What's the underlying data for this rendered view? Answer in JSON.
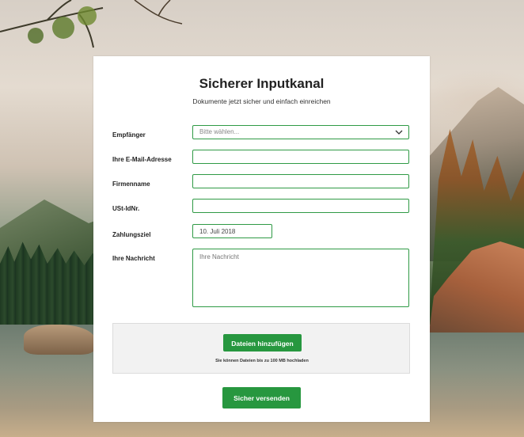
{
  "form": {
    "title": "Sicherer Inputkanal",
    "subtitle": "Dokumente jetzt sicher und einfach einreichen",
    "fields": {
      "recipient": {
        "label": "Empfänger",
        "placeholder": "Bitte wählen..."
      },
      "email": {
        "label": "Ihre E-Mail-Adresse",
        "value": ""
      },
      "company": {
        "label": "Firmenname",
        "value": ""
      },
      "vat": {
        "label": "USt-IdNr.",
        "value": ""
      },
      "due_date": {
        "label": "Zahlungsziel",
        "value": "10. Juli 2018"
      },
      "message": {
        "label": "Ihre Nachricht",
        "placeholder": "Ihre Nachricht"
      }
    },
    "upload": {
      "button_label": "Dateien hinzufügen",
      "note": "Sie können Dateien bis zu 100 MB hochladen"
    },
    "submit_label": "Sicher versenden"
  },
  "colors": {
    "accent": "#27973f",
    "field_border": "#2f9a45"
  },
  "icons": {
    "select_arrow": "chevron-down-icon"
  }
}
